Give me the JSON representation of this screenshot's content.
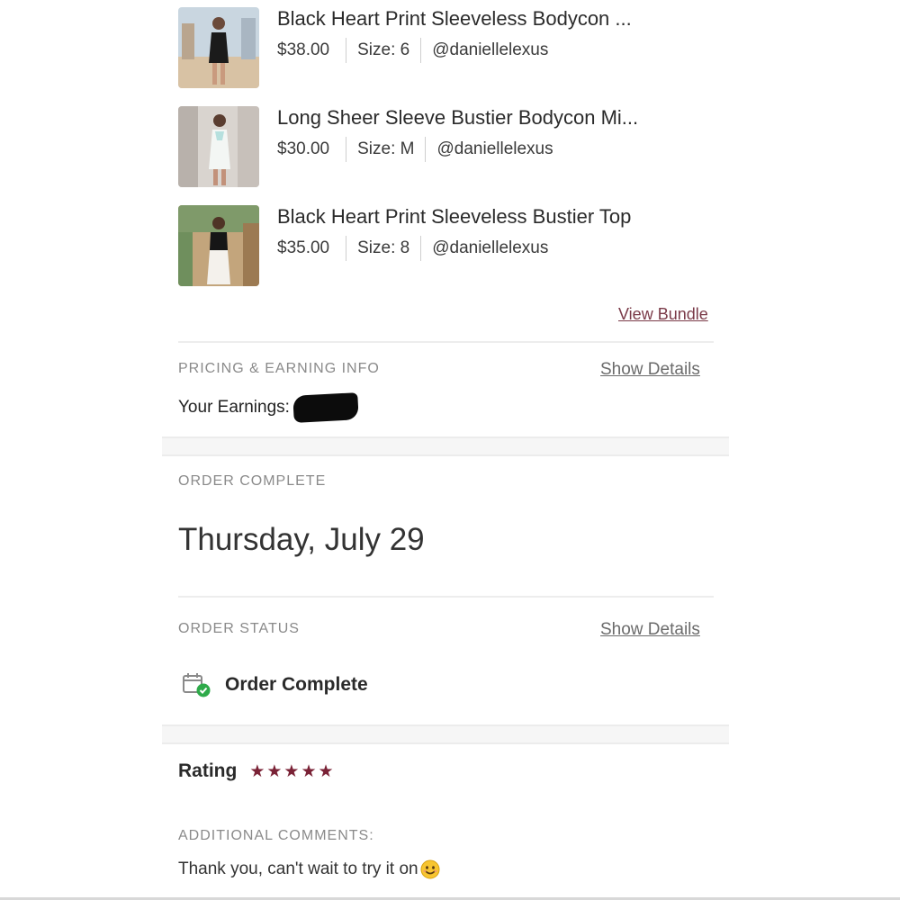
{
  "bundle": {
    "items": [
      {
        "title": "Black Heart Print Sleeveless Bodycon ...",
        "price": "$38.00",
        "size": "Size: 6",
        "seller": "@daniellelexus",
        "thumbnail_icon": "black-dress-photo"
      },
      {
        "title": "Long Sheer Sleeve Bustier Bodycon Mi...",
        "price": "$30.00",
        "size": "Size: M",
        "seller": "@daniellelexus",
        "thumbnail_icon": "white-dress-photo"
      },
      {
        "title": "Black Heart Print Sleeveless Bustier Top",
        "price": "$35.00",
        "size": "Size: 8",
        "seller": "@daniellelexus",
        "thumbnail_icon": "black-top-photo"
      }
    ],
    "view_bundle_label": "View Bundle"
  },
  "pricing": {
    "section_label": "PRICING & EARNING INFO",
    "show_details_label": "Show Details",
    "earnings_label": "Your Earnings:"
  },
  "order_complete": {
    "section_label": "ORDER COMPLETE",
    "date": "Thursday, July 29"
  },
  "order_status": {
    "section_label": "ORDER STATUS",
    "show_details_label": "Show Details",
    "status_text": "Order Complete",
    "status_icon": "calendar-check-icon"
  },
  "rating": {
    "label": "Rating",
    "stars": 5,
    "max_stars": 5,
    "star_color": "#7a2236"
  },
  "comments": {
    "section_label": "ADDITIONAL COMMENTS:",
    "text": "Thank you, can't wait to try it on",
    "emoji": "smiling-face-emoji"
  },
  "colors": {
    "link_accent": "#7a3a48",
    "section_label": "#8a8a8a"
  }
}
